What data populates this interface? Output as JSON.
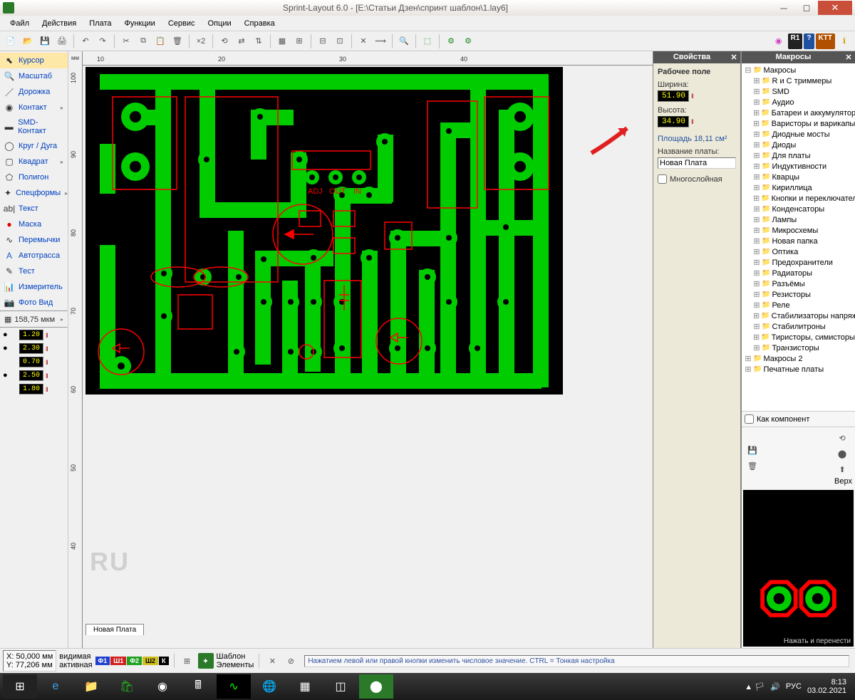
{
  "title": "Sprint-Layout 6.0 - [E:\\Статьи Дзен\\спринт шаблон\\1.lay6]",
  "menu": [
    "Файл",
    "Действия",
    "Плата",
    "Функции",
    "Сервис",
    "Опции",
    "Справка"
  ],
  "tools": [
    {
      "icon": "⬉",
      "label": "Курсор",
      "sel": true
    },
    {
      "icon": "🔍",
      "label": "Масштаб"
    },
    {
      "icon": "／",
      "label": "Дорожка"
    },
    {
      "icon": "◉",
      "label": "Контакт",
      "arrow": true
    },
    {
      "icon": "▬",
      "label": "SMD-Контакт"
    },
    {
      "icon": "◯",
      "label": "Круг / Дуга"
    },
    {
      "icon": "▢",
      "label": "Квадрат",
      "arrow": true
    },
    {
      "icon": "⬠",
      "label": "Полигон"
    },
    {
      "icon": "✦",
      "label": "Спецформы",
      "arrow": true
    },
    {
      "icon": "ab|",
      "label": "Текст"
    },
    {
      "icon": "●",
      "label": "Маска",
      "iconColor": "#d00"
    },
    {
      "icon": "∿",
      "label": "Перемычки"
    },
    {
      "icon": "A",
      "label": "Автотрасса",
      "iconColor": "#2060c0"
    },
    {
      "icon": "✎",
      "label": "Тест"
    },
    {
      "icon": "📊",
      "label": "Измеритель"
    },
    {
      "icon": "📷",
      "label": "Фото Вид"
    }
  ],
  "grid_label": "158,75 мкм",
  "params": {
    "track": "1.20",
    "pad_out": "2.30",
    "pad_in": "0.70",
    "smd_w": "2.50",
    "smd_h": "1.80"
  },
  "ruler_unit": "мм",
  "ruler_h": [
    "100",
    "90",
    "80",
    "70",
    "60",
    "50",
    "40"
  ],
  "ruler_v_vals": [
    "10",
    "20",
    "30",
    "40"
  ],
  "ru": "RU",
  "board_tab": "Новая Плата",
  "props": {
    "title": "Свойства",
    "heading": "Рабочее поле",
    "width_label": "Ширина:",
    "width": "51.90",
    "height_label": "Высота:",
    "height": "34.90",
    "area": "Площадь 18,11 см²",
    "name_label": "Название платы:",
    "name": "Новая Плата",
    "multilayer": "Многослойная"
  },
  "macros": {
    "title": "Макросы",
    "root": "Макросы",
    "items": [
      "R и C триммеры",
      "SMD",
      "Аудио",
      "Батареи и аккумуляторы",
      "Варисторы и варикапы",
      "Диодные мосты",
      "Диоды",
      "Для платы",
      "Индуктивности",
      "Кварцы",
      "Кириллица",
      "Кнопки и переключатели",
      "Конденсаторы",
      "Лампы",
      "Микросхемы",
      "Новая папка",
      "Оптика",
      "Предохранители",
      "Радиаторы",
      "Разъёмы",
      "Резисторы",
      "Реле",
      "Стабилизаторы напряжени",
      "Стабилитроны",
      "Тиристоры, симисторы",
      "Транзисторы"
    ],
    "extra": [
      "Макросы 2",
      "Печатные платы"
    ],
    "as_component": "Как компонент",
    "up": "Верх",
    "hint": "Нажать и перенести"
  },
  "status": {
    "x_label": "X:",
    "x": "50,000 мм",
    "y_label": "Y:",
    "y": "77,206 мм",
    "visible": "видимая",
    "active": "активная",
    "layers": [
      "Ф1",
      "Ш1",
      "Ф2",
      "Ш2",
      "К"
    ],
    "template": "Шаблон",
    "elements": "Элементы",
    "hint": "Нажатием левой или правой кнопки изменить числовое значение. CTRL = Тонкая настройка"
  },
  "tray": {
    "lang": "РУС",
    "time": "8:13",
    "date": "03.02.2021"
  },
  "toolbar_badges": [
    "R1",
    "?"
  ],
  "pcb_text": {
    "adj": "ADJ",
    "out": "OUT",
    "in": "IN"
  }
}
